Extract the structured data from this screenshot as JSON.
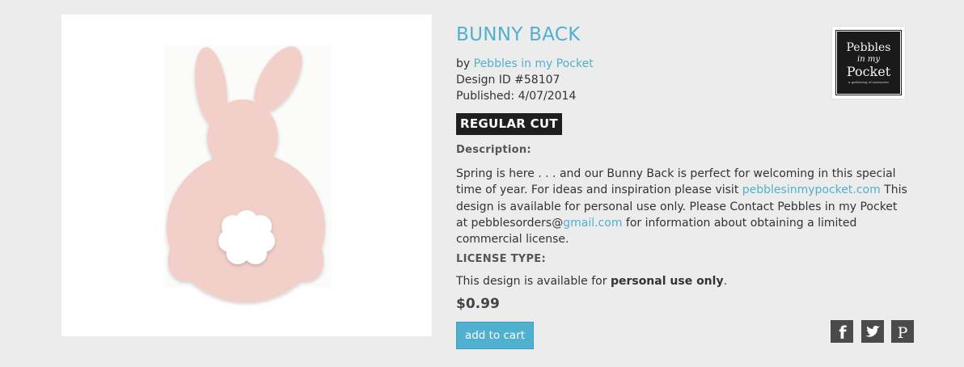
{
  "product": {
    "title": "BUNNY BACK",
    "by_prefix": "by",
    "author": "Pebbles in my Pocket",
    "design_id": "Design ID #58107",
    "published": "Published: 4/07/2014",
    "cut_type": "REGULAR CUT",
    "description_label": "Description:",
    "description": {
      "part1": "Spring is here . . . and our Bunny Back is perfect for welcoming in this special time of year. For ideas and inspiration please visit ",
      "link1": "pebblesinmypocket.com",
      "part2": " This design is available for personal use only. Please Contact Pebbles in my Pocket at pebblesorders@",
      "link2": "gmail.com",
      "part3": " for information about obtaining a limited commercial license."
    },
    "license_label": "LICENSE TYPE:",
    "license_prefix": "This design is available for ",
    "license_bold": "personal use only",
    "license_suffix": ".",
    "price": "$0.99",
    "add_to_cart": "add to cart"
  },
  "logo": {
    "line1": "Pebbles",
    "line2": "in my",
    "line3": "Pocket",
    "tagline": "a gathering of memories"
  },
  "social": {
    "facebook": "f",
    "twitter": "twitter-icon",
    "pinterest": "P"
  },
  "colors": {
    "accent": "#4fb0cf",
    "badge_bg": "#1f1f1f",
    "bunny": "#f2d0c9",
    "background": "#ececec"
  }
}
